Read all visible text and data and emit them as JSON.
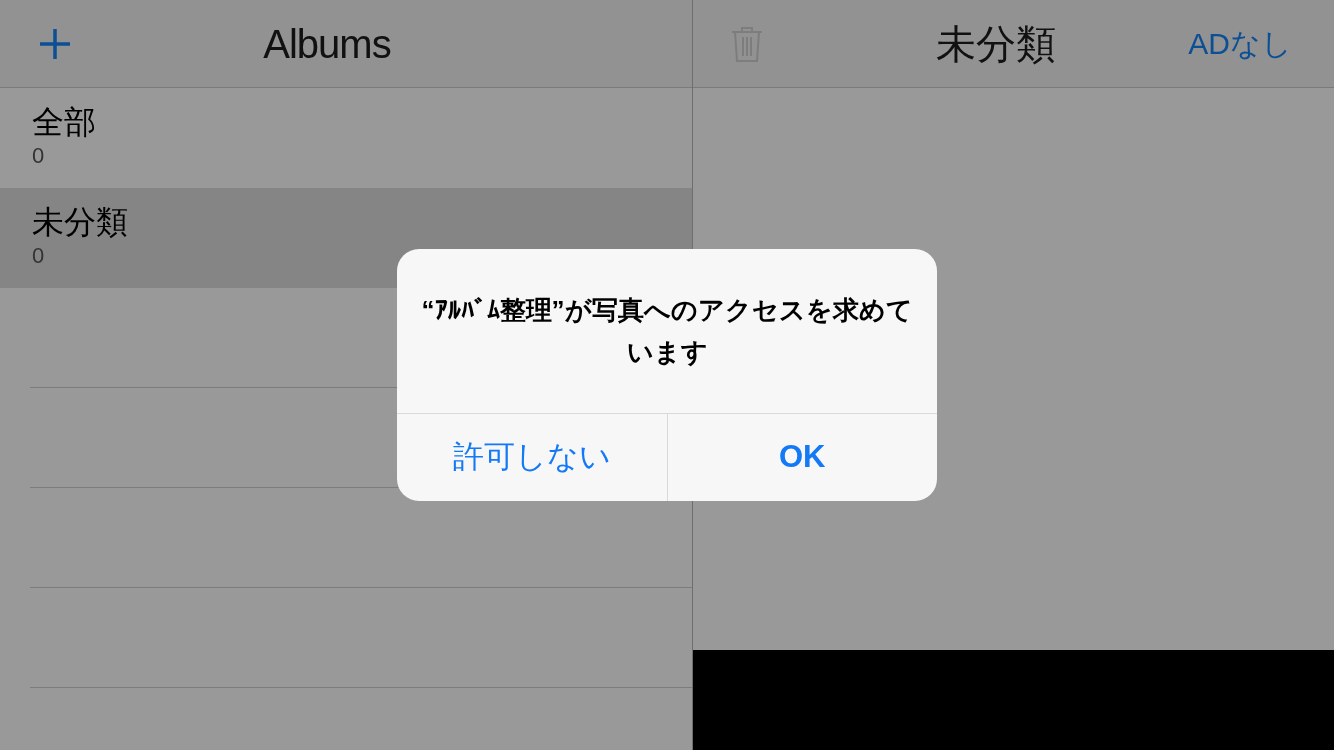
{
  "albums_panel": {
    "title": "Albums",
    "albums": [
      {
        "name": "全部",
        "count": "0",
        "selected": false
      },
      {
        "name": "未分類",
        "count": "0",
        "selected": true
      }
    ]
  },
  "detail_panel": {
    "title": "未分類",
    "ad_button": "ADなし"
  },
  "alert": {
    "title": "“ｱﾙﾊﾞﾑ整理”が写真へのアクセスを求めています",
    "buttons": [
      {
        "label": "許可しない",
        "kind": "cancel"
      },
      {
        "label": "OK",
        "kind": "default"
      }
    ]
  }
}
